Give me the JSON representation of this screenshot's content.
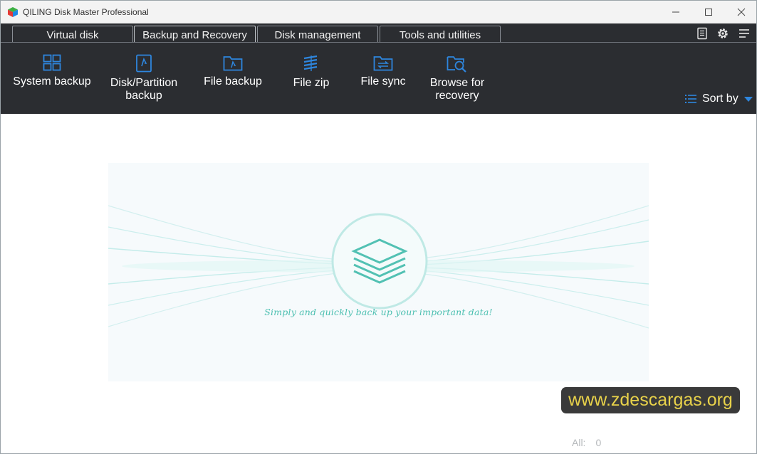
{
  "window": {
    "title": "QILING Disk Master Professional"
  },
  "tabs": [
    {
      "label": "Virtual disk",
      "active": false
    },
    {
      "label": "Backup and Recovery",
      "active": true
    },
    {
      "label": "Disk management",
      "active": false
    },
    {
      "label": "Tools and utilities",
      "active": false
    }
  ],
  "header_icons": [
    "notes-icon",
    "gear-icon",
    "menu-icon"
  ],
  "toolbar": {
    "system_backup": "System backup",
    "disk_partition_line1": "Disk/Partition",
    "disk_partition_line2": "backup",
    "file_backup": "File backup",
    "file_zip": "File zip",
    "file_sync": "File sync",
    "browse_line1": "Browse for",
    "browse_line2": "recovery",
    "sort_by": "Sort by"
  },
  "content": {
    "empty_message": "Simply and quickly back up your important data!",
    "all_label": "All:",
    "all_count": "0"
  },
  "watermark": {
    "text": "www.zdescargas.org"
  },
  "colors": {
    "accent": "#2e86de",
    "toolbar_bg": "#2b2d31",
    "teal": "#4bbfb0",
    "watermark_text": "#e8d24a"
  }
}
